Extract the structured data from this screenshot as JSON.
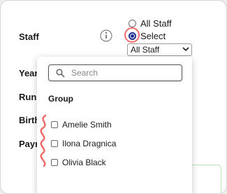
{
  "form": {
    "labels": {
      "staff": "Staff",
      "year": "Year",
      "run": "Run",
      "birth": "Birth",
      "pay": "Payr"
    }
  },
  "staff": {
    "radio_all": "All Staff",
    "radio_select": "Select",
    "selected_option": "Select",
    "dropdown_value": "All Staff"
  },
  "popup": {
    "search_placeholder": "Search",
    "group_heading": "Group",
    "items": [
      {
        "label": "Amelie Smith",
        "checked": false
      },
      {
        "label": "Ilona Dragnica",
        "checked": false
      },
      {
        "label": "Olivia Black",
        "checked": false
      }
    ]
  },
  "colors": {
    "accent": "#1a2f8f",
    "highlight": "#f26b6b",
    "field_border": "#b9e2b9"
  },
  "icons": [
    "info-icon",
    "search-icon",
    "chevron-down-icon"
  ]
}
